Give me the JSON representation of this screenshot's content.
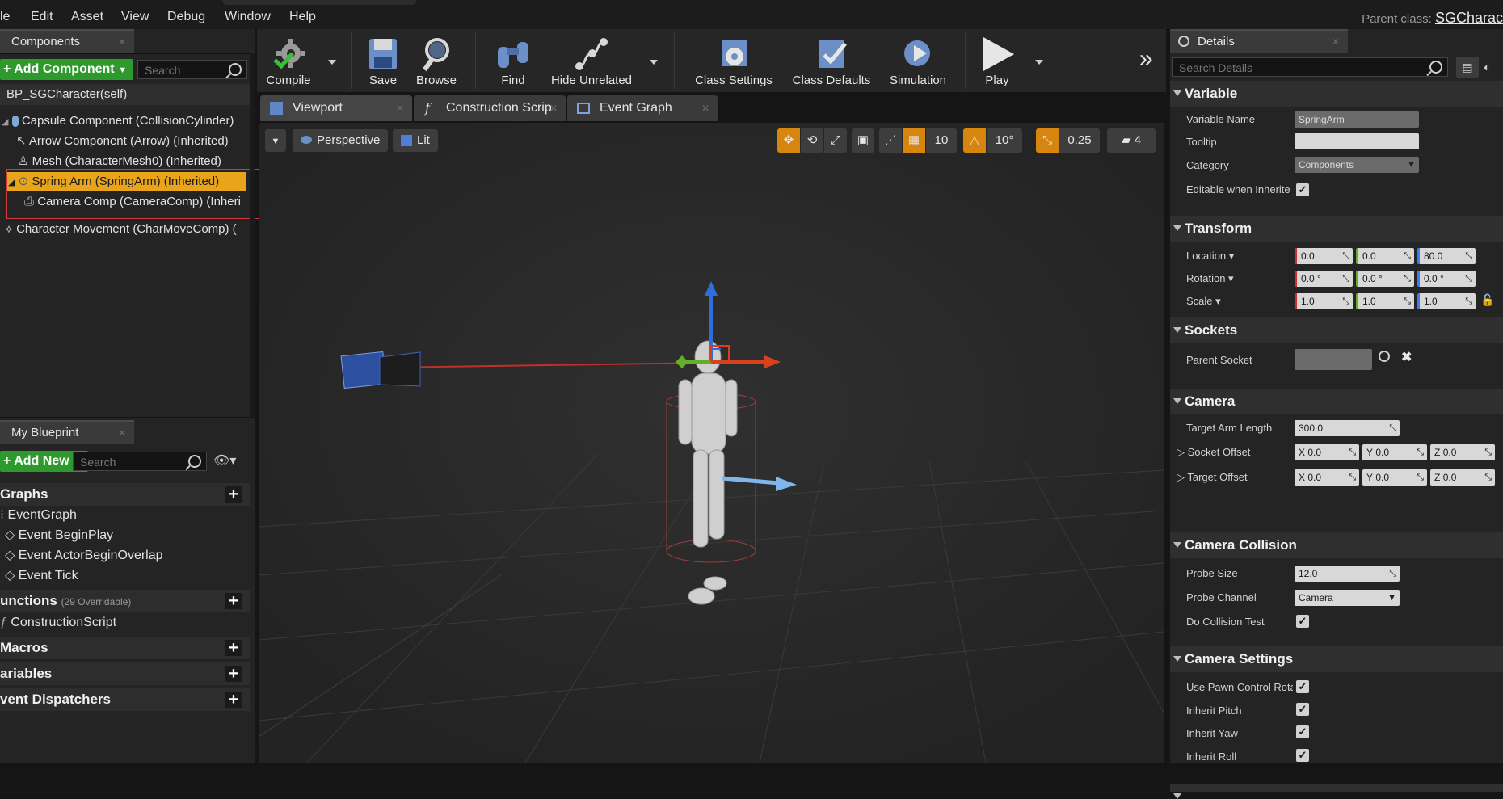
{
  "menu": [
    "le",
    "Edit",
    "Asset",
    "View",
    "Debug",
    "Window",
    "Help"
  ],
  "parent_class": {
    "label": "Parent class:",
    "value": "SGCharac"
  },
  "components_panel": {
    "tab": "Components",
    "add_button": "+ Add Component",
    "search_placeholder": "Search",
    "self_row": "BP_SGCharacter(self)",
    "tree": [
      "Capsule Component (CollisionCylinder)",
      "Arrow Component (Arrow) (Inherited)",
      "Mesh (CharacterMesh0) (Inherited)",
      "Spring Arm (SpringArm) (Inherited)",
      "Camera Comp (CameraComp) (Inheri",
      "Character Movement (CharMoveComp) ("
    ],
    "selected_color": "#e8a51b",
    "highlight_box_color": "#d13b3b"
  },
  "my_blueprint": {
    "tab": "My Blueprint",
    "add_button": "+ Add New",
    "search_placeholder": "Search",
    "graphs_label": "Graphs",
    "graph_items": [
      "EventGraph",
      "Event BeginPlay",
      "Event ActorBeginOverlap",
      "Event Tick"
    ],
    "functions_label": "unctions",
    "functions_count": "(29 Overridable)",
    "function_items": [
      "ConstructionScript"
    ],
    "macros_label": "Macros",
    "variables_label": "ariables",
    "dispatchers_label": "vent Dispatchers"
  },
  "toolbar": {
    "compile": "Compile",
    "save": "Save",
    "browse": "Browse",
    "find": "Find",
    "hide_unrelated": "Hide Unrelated",
    "class_settings": "Class Settings",
    "class_defaults": "Class Defaults",
    "simulation": "Simulation",
    "play": "Play"
  },
  "doc_tabs": [
    "Viewport",
    "Construction Scrip",
    "Event Graph"
  ],
  "viewport": {
    "perspective": "Perspective",
    "lit": "Lit",
    "grid_snap": "10",
    "rot_snap": "10°",
    "scale_snap": "0.25",
    "camera_speed": "4"
  },
  "details": {
    "tab": "Details",
    "search_placeholder": "Search Details",
    "variable": {
      "title": "Variable",
      "variable_name_label": "Variable Name",
      "variable_name_value": "SpringArm",
      "tooltip_label": "Tooltip",
      "tooltip_value": "",
      "category_label": "Category",
      "category_value": "Components",
      "editable_label": "Editable when Inherite"
    },
    "transform": {
      "title": "Transform",
      "location_label": "Location",
      "location": [
        "0.0",
        "0.0",
        "80.0"
      ],
      "rotation_label": "Rotation",
      "rotation": [
        "0.0 °",
        "0.0 °",
        "0.0 °"
      ],
      "scale_label": "Scale",
      "scale": [
        "1.0",
        "1.0",
        "1.0"
      ]
    },
    "sockets": {
      "title": "Sockets",
      "parent_socket_label": "Parent Socket"
    },
    "camera": {
      "title": "Camera",
      "target_arm_length_label": "Target Arm Length",
      "target_arm_length": "300.0",
      "socket_offset_label": "Socket Offset",
      "socket_offset": [
        "0.0",
        "0.0",
        "0.0"
      ],
      "target_offset_label": "Target Offset",
      "target_offset": [
        "0.0",
        "0.0",
        "0.0"
      ],
      "axis_letters": [
        "X",
        "Y",
        "Z"
      ]
    },
    "camera_collision": {
      "title": "Camera Collision",
      "probe_size_label": "Probe Size",
      "probe_size": "12.0",
      "probe_channel_label": "Probe Channel",
      "probe_channel": "Camera",
      "do_collision_label": "Do Collision Test"
    },
    "camera_settings": {
      "title": "Camera Settings",
      "use_pawn_label": "Use Pawn Control Rota",
      "inherit_pitch_label": "Inherit Pitch",
      "inherit_yaw_label": "Inherit Yaw",
      "inherit_roll_label": "Inherit Roll"
    }
  }
}
